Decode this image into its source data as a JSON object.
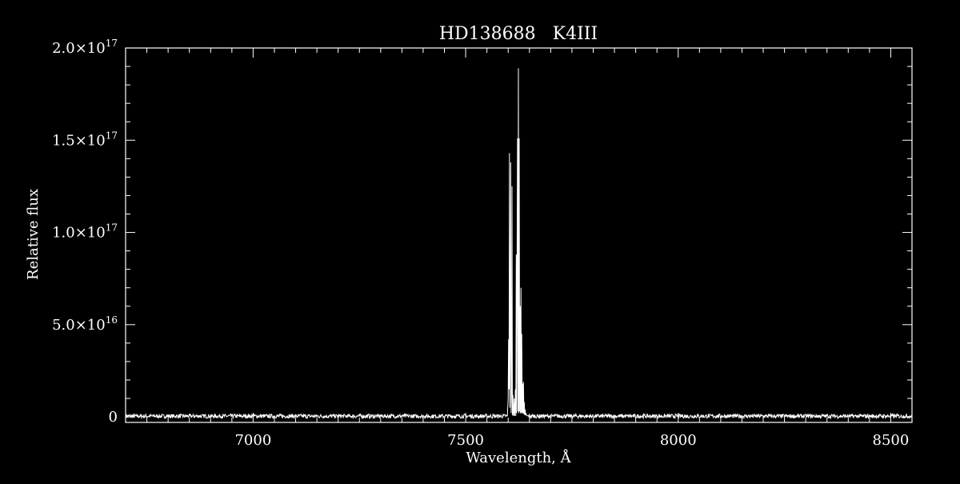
{
  "chart_data": {
    "type": "line",
    "title": "HD138688   K4III",
    "xlabel": "Wavelength, Å",
    "ylabel": "Relative flux",
    "xlim": [
      6700,
      8550
    ],
    "ylim": [
      -3000000000000000.0,
      2e+17
    ],
    "x_ticks": [
      7000,
      7500,
      8000,
      8500
    ],
    "x_tick_labels": [
      "7000",
      "7500",
      "8000",
      "8500"
    ],
    "x_minor_step": 50,
    "y_ticks": [
      {
        "value": 0,
        "mantissa": "0",
        "exponent": ""
      },
      {
        "value": 5e+16,
        "mantissa": "5.0×10",
        "exponent": "16"
      },
      {
        "value": 1e+17,
        "mantissa": "1.0×10",
        "exponent": "17"
      },
      {
        "value": 1.5e+17,
        "mantissa": "1.5×10",
        "exponent": "17"
      },
      {
        "value": 2e+17,
        "mantissa": "2.0×10",
        "exponent": "17"
      }
    ],
    "y_minor_step": 1e+16,
    "grid": false,
    "colors": {
      "background": "#000000",
      "foreground": "#ffffff"
    },
    "continuum_level": 500000000000000.0,
    "series": [
      {
        "x": [
          7598,
          7600,
          7601,
          7602,
          7603,
          7604,
          7605,
          7606,
          7607,
          7608,
          7609,
          7610,
          7611,
          7612,
          7613,
          7614,
          7615,
          7616,
          7617,
          7618,
          7619,
          7620,
          7621,
          7622,
          7623,
          7624,
          7625,
          7626,
          7627,
          7628,
          7629,
          7630,
          7631,
          7632,
          7633,
          7634,
          7635,
          7636,
          7637,
          7638,
          7639,
          7640,
          7641,
          7642,
          7643,
          7645
        ],
        "y": [
          500000000000000.0,
          1e+16,
          4.2e+16,
          1.5e+16,
          1.43e+17,
          5000000000000000.0,
          4.8e+16,
          1.38e+17,
          2000000000000000.0,
          1.3e+16,
          1.25e+17,
          800000000000000.0,
          1.2e+16,
          2000000000000000.0,
          500000000000000.0,
          1e+16,
          500000000000000.0,
          3000000000000000.0,
          1.5e+16,
          500000000000000.0,
          8.8e+16,
          2000000000000000.0,
          9e+16,
          1.51e+17,
          3000000000000000.0,
          1.89e+17,
          2000000000000000.0,
          1.51e+17,
          3000000000000000.0,
          6e+16,
          2000000000000000.0,
          7e+16,
          2000000000000000.0,
          4.5e+16,
          2000000000000000.0,
          1.8e+16,
          2000000000000000.0,
          1.9e+16,
          1500000000000000.0,
          8000000000000000.0,
          1000000000000000.0,
          4000000000000000.0,
          1000000000000000.0,
          2000000000000000.0,
          800000000000000.0,
          500000000000000.0
        ]
      }
    ]
  }
}
